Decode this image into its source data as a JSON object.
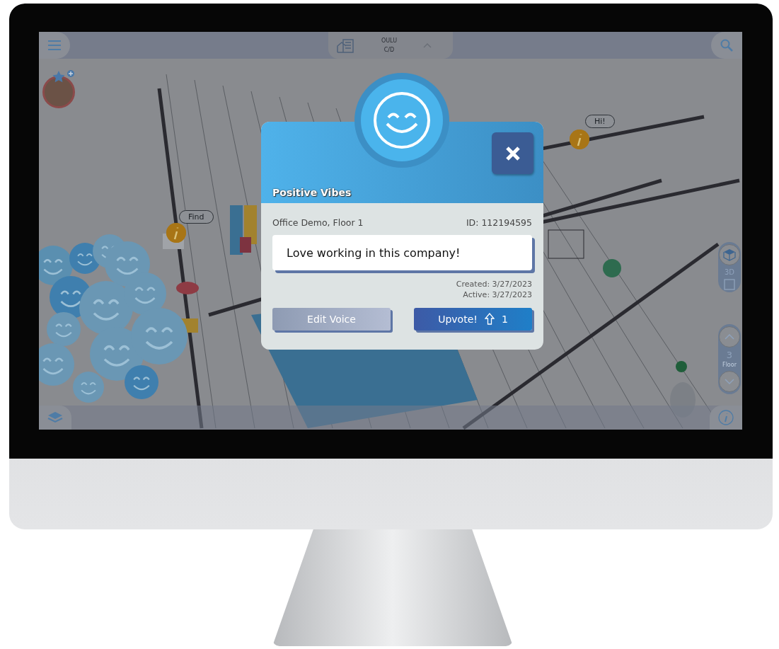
{
  "top_bar": {
    "site": "OULU",
    "building": "C/D"
  },
  "map": {
    "markers": [
      {
        "kind": "speech",
        "label": "Find"
      },
      {
        "kind": "speech",
        "label": "Hi!"
      }
    ]
  },
  "side_controls": {
    "view_label": "3D",
    "floor_number": "3",
    "floor_label": "Floor"
  },
  "dialog": {
    "title": "Positive Vibes",
    "location": "Office Demo, Floor 1",
    "id": "ID: 112194595",
    "message": "Love working in this company!",
    "created": "Created: 3/27/2023",
    "active": "Active: 3/27/2023",
    "buttons": [
      {
        "kind": "secondary",
        "label": "Edit Voice"
      },
      {
        "kind": "primary",
        "label": "Upvote!",
        "count": "1"
      }
    ]
  }
}
